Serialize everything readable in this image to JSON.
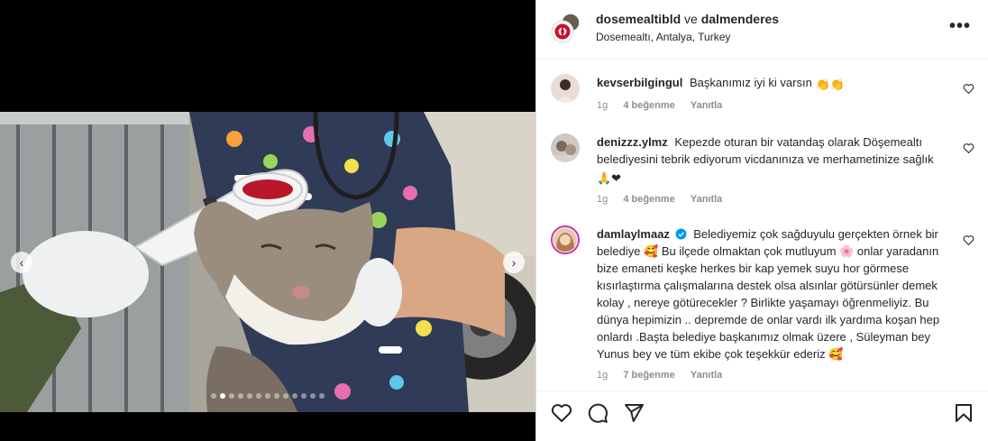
{
  "post": {
    "author": "dosemealtibld",
    "connector": "ve",
    "collaborator": "dalmenderes",
    "location": "Dosemealtı, Antalya, Turkey",
    "more_label": "•••"
  },
  "carousel": {
    "total_slides": 13,
    "active_slide": 2,
    "prev_glyph": "‹",
    "next_glyph": "›"
  },
  "comments": [
    {
      "user": "kevserbilgingul",
      "text": "Başkanımız iyi ki varsın",
      "emoji": "👏👏",
      "time": "1g",
      "likes": "4 beğenme",
      "reply": "Yanıtla"
    },
    {
      "user": "denizzz.ylmz",
      "text": "Kepezde oturan bir vatandaş olarak Döşemealtı belediyesini tebrik ediyorum vicdanınıza ve merhametinize sağlık",
      "emoji": "🙏❤",
      "time": "1g",
      "likes": "4 beğenme",
      "reply": "Yanıtla"
    },
    {
      "user": "damlaylmaaz",
      "verified": true,
      "text": "Belediyemiz çok sağduyulu gerçekten örnek bir belediye 🥰 Bu ilçede olmaktan çok mutluyum 🌸 onlar yaradanın bize emaneti keşke herkes bir kap yemek suyu hor görmese kısırlaştırma çalışmalarına destek olsa alsınlar götürsünler demek kolay , nereye götürecekler ? Birlikte yaşamayı öğrenmeliyiz. Bu dünya hepimizin .. depremde de onlar vardı ilk yardıma koşan hep onlardı .Başta belediye başkanımız olmak üzere , Süleyman bey Yunus bey ve tüm ekibe çok teşekkür ederiz 🥰",
      "time": "1g",
      "likes": "7 beğenme",
      "reply": "Yanıtla"
    }
  ],
  "colors": {
    "text": "#262626",
    "muted": "#8e8e8e",
    "verified": "#0095f6",
    "heart_red": "#ed1c24"
  },
  "icons": {
    "like": "heart-icon",
    "comment": "comment-icon",
    "share": "share-icon",
    "save": "bookmark-icon"
  }
}
